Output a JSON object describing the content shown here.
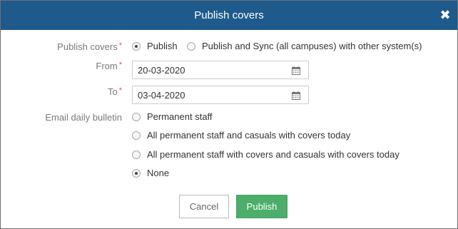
{
  "dialog": {
    "title": "Publish covers",
    "close_symbol": "✖"
  },
  "publish_covers": {
    "label": "Publish covers",
    "required": "*",
    "options": [
      {
        "label": "Publish",
        "selected": true
      },
      {
        "label": "Publish and Sync (all campuses) with other system(s)",
        "selected": false
      }
    ]
  },
  "from": {
    "label": "From",
    "required": "*",
    "value": "20-03-2020",
    "icon": "calendar-icon"
  },
  "to": {
    "label": "To",
    "required": "*",
    "value": "03-04-2020",
    "icon": "calendar-icon"
  },
  "email_daily_bulletin": {
    "label": "Email daily bulletin",
    "options": [
      {
        "label": "Permanent staff",
        "selected": false
      },
      {
        "label": "All permanent staff and casuals with covers today",
        "selected": false
      },
      {
        "label": "All permanent staff with covers and casuals with covers today",
        "selected": false
      },
      {
        "label": "None",
        "selected": true
      }
    ]
  },
  "buttons": {
    "cancel": "Cancel",
    "publish": "Publish"
  },
  "colors": {
    "header": "#1e5a8c",
    "publish_button": "#4cae6a",
    "required_star": "#d9534f"
  }
}
